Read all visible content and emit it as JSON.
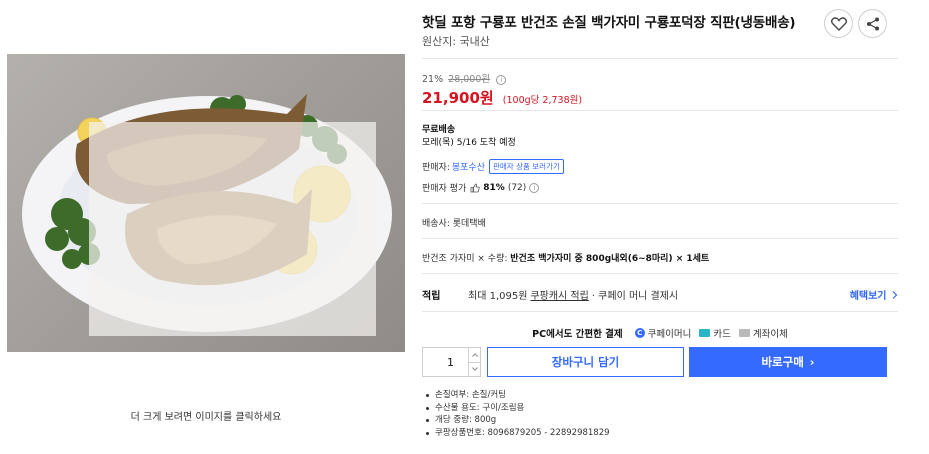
{
  "image": {
    "caption": "더 크게 보려면 이미지를 클릭하세요"
  },
  "product": {
    "title": "핫딜 포항 구룡포 반건조 손질 백가자미 구룡포덕장 직판(냉동배송)",
    "origin": "원산지: 국내산",
    "like_icon": "heart-icon",
    "share_icon": "share-icon"
  },
  "price": {
    "discount_rate": "21%",
    "original_price": "28,000원",
    "info_mark": "i",
    "sale_price": "21,900원",
    "unit_price": "(100g당 2,738원)"
  },
  "shipping": {
    "type": "무료배송",
    "arrival": "모레(목) 5/16 도착 예정"
  },
  "seller": {
    "label": "판매자:",
    "name": "봉포수산",
    "other_products_button": "판매자 상품 보러가기",
    "rating_label": "판매자 평가",
    "rating_pct": "81%",
    "rating_count": "(72)"
  },
  "carrier": "배송사: 롯데택배",
  "option": {
    "prefix": "반건조 가자미 × 수량:",
    "value": "반건조 백가자미 중 800g내외(6~8마리) × 1세트"
  },
  "points": {
    "label": "적립",
    "text_before": "최대 1,095원",
    "cash_link": "쿠팡캐시 적립",
    "text_after": "· 쿠페이 머니 결제시",
    "benefit_link": "혜택보기"
  },
  "payment": {
    "heading": "PC에서도 간편한 결제",
    "coupay_mark": "C",
    "methods": [
      "쿠페이머니",
      "카드",
      "계좌이체"
    ]
  },
  "purchase": {
    "quantity": "1",
    "cart_button": "장바구니 담기",
    "buy_button": "바로구매",
    "buy_chevron": "›"
  },
  "details": [
    "손질여부: 손질/커팅",
    "수산물 용도: 구이/조림용",
    "개당 중량: 800g",
    "쿠팡상품번호: 8096879205 - 22892981829"
  ],
  "colors": {
    "accent": "#346aff",
    "sale": "#d7131f"
  }
}
